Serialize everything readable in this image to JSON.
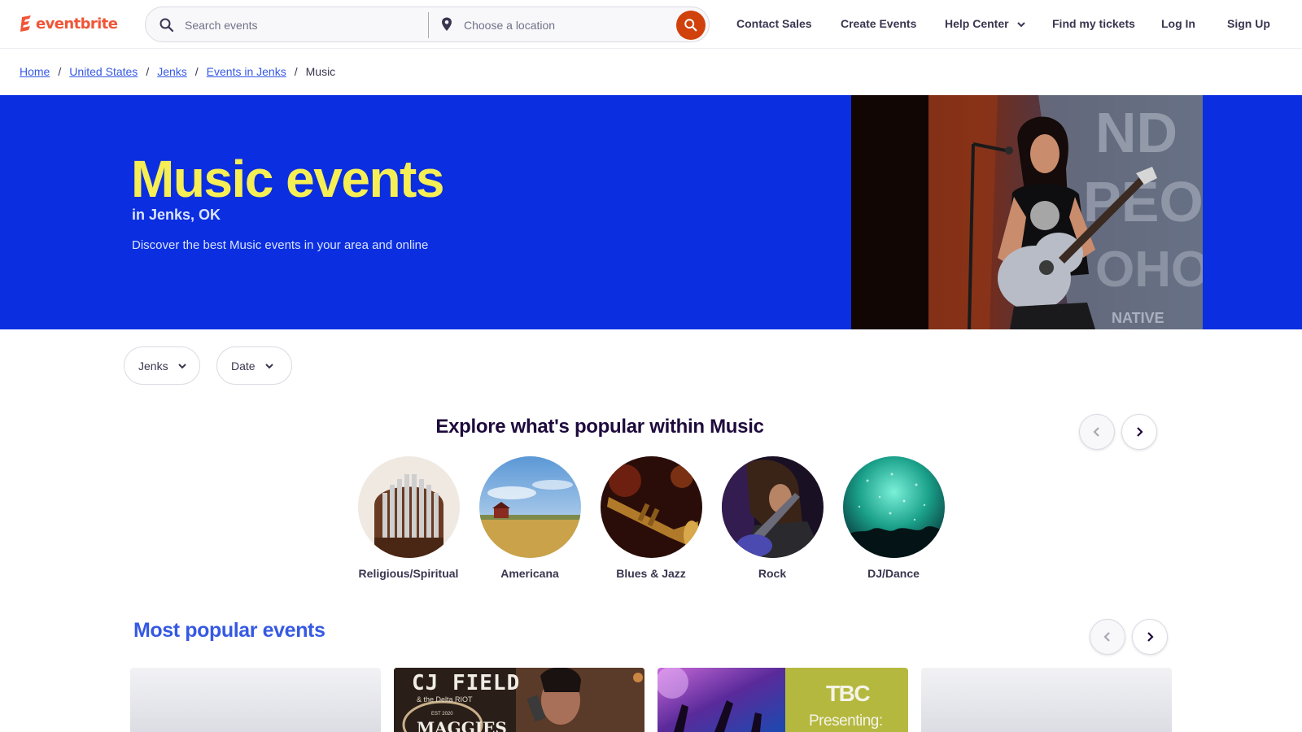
{
  "brand": {
    "name": "eventbrite",
    "color": "#f05537"
  },
  "search": {
    "placeholder": "Search events",
    "location_placeholder": "Choose a location",
    "button_color": "#d1410c"
  },
  "nav": {
    "contact_sales": "Contact Sales",
    "create_events": "Create Events",
    "help_center": "Help Center",
    "find_tickets": "Find my tickets",
    "log_in": "Log In",
    "sign_up": "Sign Up"
  },
  "breadcrumb": {
    "home": "Home",
    "country": "United States",
    "city": "Jenks",
    "events_in_city": "Events in Jenks",
    "current": "Music",
    "separator": "/"
  },
  "hero": {
    "title": "Music events",
    "subtitle": "in Jenks, OK",
    "description": "Discover the best Music events in your area and online",
    "background_color": "#0b2ee0",
    "title_color": "#f5ee54"
  },
  "filters": {
    "location": "Jenks",
    "date": "Date"
  },
  "explore": {
    "title": "Explore what's popular within Music",
    "categories": [
      {
        "label": "Religious/Spiritual"
      },
      {
        "label": "Americana"
      },
      {
        "label": "Blues & Jazz"
      },
      {
        "label": "Rock"
      },
      {
        "label": "DJ/Dance"
      }
    ]
  },
  "popular": {
    "title": "Most popular events",
    "cards": [
      {
        "headline": ""
      },
      {
        "headline": "CJ FIELD",
        "subline": "& the Delta RIOT",
        "venue": "MAGGIES",
        "est": "EST 2020"
      },
      {
        "headline": "TBC",
        "subline": "Presenting:"
      },
      {
        "headline": ""
      }
    ]
  }
}
